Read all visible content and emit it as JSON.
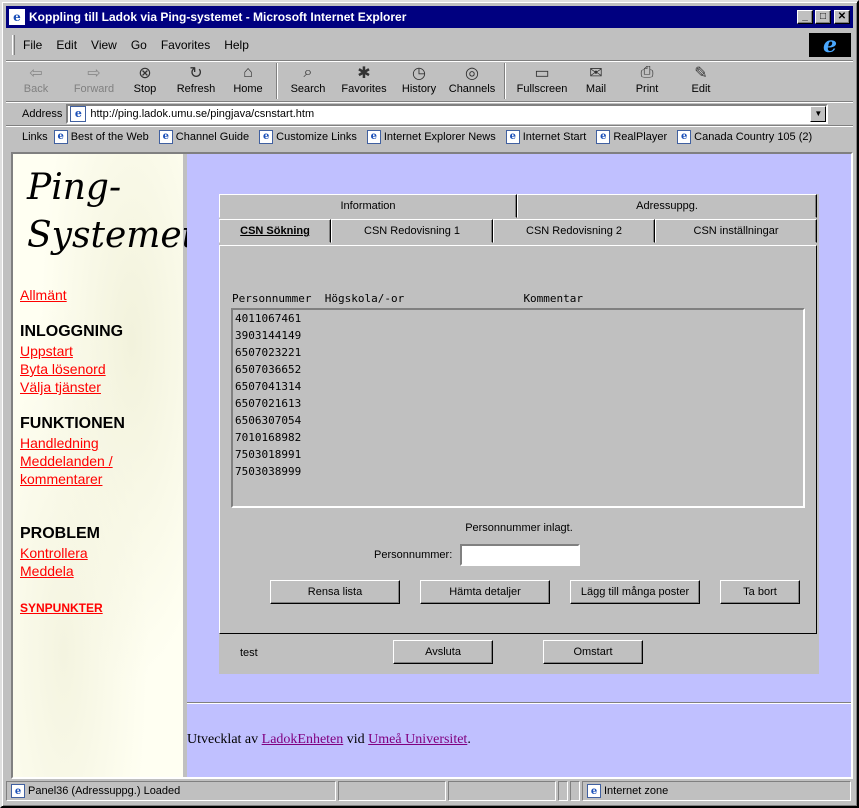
{
  "window": {
    "title": "Koppling till Ladok via Ping-systemet - Microsoft Internet Explorer",
    "min": "_",
    "max": "□",
    "close": "✕"
  },
  "menu": [
    "File",
    "Edit",
    "View",
    "Go",
    "Favorites",
    "Help"
  ],
  "toolbar": [
    {
      "label": "Back",
      "icon": "back-arrow-icon",
      "glyph": "⇦",
      "disabled": true
    },
    {
      "label": "Forward",
      "icon": "forward-arrow-icon",
      "glyph": "⇨",
      "disabled": true
    },
    {
      "label": "Stop",
      "icon": "stop-icon",
      "glyph": "⊗"
    },
    {
      "label": "Refresh",
      "icon": "refresh-icon",
      "glyph": "↻"
    },
    {
      "label": "Home",
      "icon": "home-icon",
      "glyph": "⌂"
    },
    {
      "label": "Search",
      "icon": "search-icon",
      "glyph": "⌕"
    },
    {
      "label": "Favorites",
      "icon": "favorites-icon",
      "glyph": "✱"
    },
    {
      "label": "History",
      "icon": "history-icon",
      "glyph": "◷"
    },
    {
      "label": "Channels",
      "icon": "channels-icon",
      "glyph": "◎"
    },
    {
      "label": "Fullscreen",
      "icon": "fullscreen-icon",
      "glyph": "▭"
    },
    {
      "label": "Mail",
      "icon": "mail-icon",
      "glyph": "✉"
    },
    {
      "label": "Print",
      "icon": "print-icon",
      "glyph": "⎙"
    },
    {
      "label": "Edit",
      "icon": "edit-icon",
      "glyph": "✎"
    }
  ],
  "address": {
    "label": "Address",
    "url": "http://ping.ladok.umu.se/pingjava/csnstart.htm"
  },
  "links": {
    "label": "Links",
    "items": [
      "Best of the Web",
      "Channel Guide",
      "Customize Links",
      "Internet Explorer News",
      "Internet Start",
      "RealPlayer",
      "Canada Country 105  (2)"
    ]
  },
  "sidebar": {
    "logo_line1": "Ping-",
    "logo_line2": "Systemet",
    "allmant": "Allmänt",
    "inloggning": "INLOGGNING",
    "uppstart": "Uppstart",
    "byta": "Byta lösenord",
    "valja": "Välja tjänster",
    "funktionen": "FUNKTIONEN",
    "handledning": "Handledning",
    "meddelanden1": "Meddelanden /",
    "meddelanden2": "kommentarer",
    "problem": "PROBLEM",
    "kontrollera": "Kontrollera",
    "meddela": "Meddela",
    "synpunkter": "SYNPUNKTER"
  },
  "tabs": {
    "top": [
      "Information",
      "Adressuppg."
    ],
    "bottom": [
      "CSN Sökning",
      "CSN Redovisning 1",
      "CSN Redovisning 2",
      "CSN inställningar"
    ]
  },
  "columns": {
    "personnummer": "Personnummer",
    "hogskola": "Högskola/-or",
    "kommentar": "Kommentar"
  },
  "rows": [
    "4011067461",
    "3903144149",
    "6507023221",
    "6507036652",
    "6507041314",
    "6507021613",
    "6506307054",
    "7010168982",
    "7503018991",
    "7503038999"
  ],
  "message": "Personnummer inlagt.",
  "pn_label": "Personnummer:",
  "pn_value": "",
  "buttons": {
    "rensa": "Rensa lista",
    "hamta": "Hämta detaljer",
    "lagg": "Lägg till många poster",
    "tabort": "Ta bort",
    "avsluta": "Avsluta",
    "omstart": "Omstart"
  },
  "bottom_text": "test",
  "credit": {
    "prefix": "Utvecklat av ",
    "link1": "LadokEnheten",
    "mid": " vid ",
    "link2": "Umeå Universitet",
    "suffix": "."
  },
  "status": {
    "main": "Panel36 (Adressuppg.) Loaded",
    "zone": "Internet zone"
  }
}
